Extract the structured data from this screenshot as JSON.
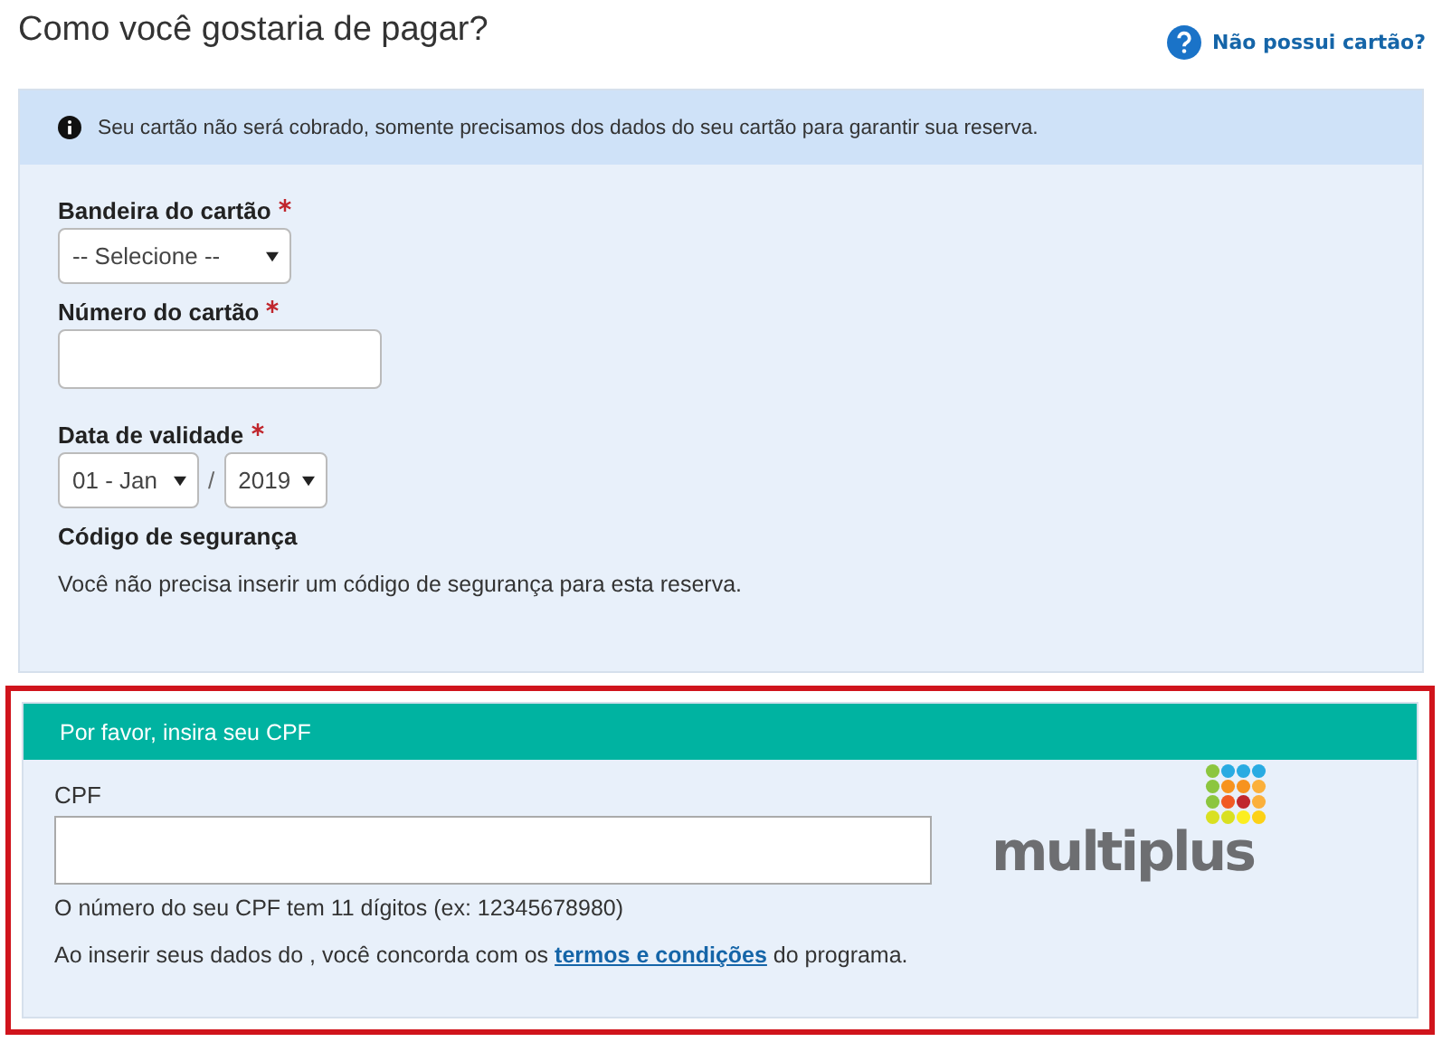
{
  "title": "Como você gostaria de pagar?",
  "help_link": "Não possui cartão?",
  "info": "Seu cartão não será cobrado, somente precisamos dos dados do seu cartão para garantir sua reserva.",
  "card_fields": [
    {
      "kind": "select",
      "label": "Bandeira do cartão",
      "required": true,
      "value": "-- Selecione --"
    },
    {
      "kind": "input",
      "label": "Número do cartão",
      "required": true
    },
    {
      "kind": "date",
      "label": "Data de validade",
      "required": true,
      "month": "01 - Jan",
      "separator": "/",
      "year": "2019"
    },
    {
      "kind": "note",
      "label": "Código de segurança",
      "required": false,
      "text": "Você não precisa inserir um código de segurança para esta reserva."
    }
  ],
  "cpf": {
    "header": "Por favor, insira seu CPF",
    "label": "CPF",
    "hint": "O número do seu CPF tem 11 dígitos (ex: 12345678980)",
    "terms_before": "Ao inserir seus dados do , você concorda com os",
    "terms_link": "termos e condições",
    "terms_after": "do programa.",
    "logo": "multiplus",
    "highlighted": true
  }
}
